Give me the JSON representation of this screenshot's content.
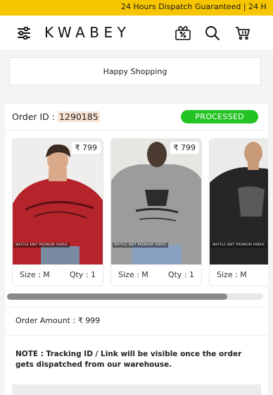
{
  "announcement": {
    "text": "24 Hours Dispatch Guaranteed  |  24 H"
  },
  "header": {
    "brand": "KWABEY"
  },
  "banner": {
    "text": "Happy Shopping"
  },
  "order": {
    "id_label": "Order ID :",
    "id_value": "1290185",
    "status": "PROCESSED",
    "amount_label": "Order Amount :",
    "currency": "₹",
    "amount_value": "999",
    "note": "NOTE : Tracking ID / Link will be visible once the order gets dispatched from our warehouse."
  },
  "products": [
    {
      "price": "₹ 799",
      "tag": "WAFFLE KNIT PREMIUM FABRIC",
      "size": "Size : M",
      "qty": "Qty : 1",
      "color": "#b5232b"
    },
    {
      "price": "₹ 799",
      "tag": "WAFFLE KNIT PREMIUM FABRIC",
      "size": "Size : M",
      "qty": "Qty : 1",
      "color": "#9c9c9c"
    },
    {
      "price": "",
      "tag": "WAFFLE KNIT PREMIUM FABRIC",
      "size": "Size : M",
      "qty": "",
      "color": "#262626"
    }
  ]
}
